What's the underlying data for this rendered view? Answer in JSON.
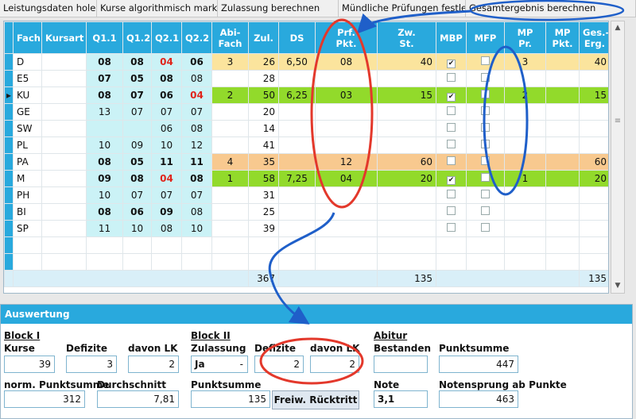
{
  "tabs": [
    "Leistungsdaten holen",
    "Kurse algorithmisch markieren",
    "Zulassung berechnen",
    "Mündliche Prüfungen festlegen",
    "Gesamtergebnis berechnen"
  ],
  "grid": {
    "headers": [
      "Fach",
      "Kursart",
      "Q1.1",
      "Q1.2",
      "Q2.1",
      "Q2.2",
      "Abi-\nFach",
      "Zul.",
      "DS",
      "Prf.\nPkt.",
      "Zw.\nSt.",
      "MBP",
      "MFP",
      "MP\nPr.",
      "MP\nPkt.",
      "Ges.-\nErg."
    ],
    "rows": [
      {
        "fach": "D",
        "kursart": "",
        "q11": "08",
        "q12": "08",
        "q21": "04",
        "q22": "06",
        "abi": "3",
        "zul": "26",
        "ds": "6,50",
        "prf": "08",
        "zw": "40",
        "mbp": "✔",
        "mfp": "",
        "mpr": "3",
        "mpk": "",
        "ges": "40"
      },
      {
        "fach": "E5",
        "kursart": "",
        "q11": "07",
        "q12": "05",
        "q21": "08",
        "q22": "08",
        "abi": "",
        "zul": "28",
        "ds": "",
        "prf": "",
        "zw": "",
        "mbp": "",
        "mfp": "",
        "mpr": "",
        "mpk": "",
        "ges": ""
      },
      {
        "fach": "KU",
        "kursart": "",
        "q11": "08",
        "q12": "07",
        "q21": "06",
        "q22": "04",
        "abi": "2",
        "zul": "50",
        "ds": "6,25",
        "prf": "03",
        "zw": "15",
        "mbp": "✔",
        "mfp": "",
        "mpr": "2",
        "mpk": "",
        "ges": "15"
      },
      {
        "fach": "GE",
        "kursart": "",
        "q11": "13",
        "q12": "07",
        "q21": "07",
        "q22": "07",
        "abi": "",
        "zul": "20",
        "ds": "",
        "prf": "",
        "zw": "",
        "mbp": "",
        "mfp": "",
        "mpr": "",
        "mpk": "",
        "ges": ""
      },
      {
        "fach": "SW",
        "kursart": "",
        "q11": "",
        "q12": "",
        "q21": "06",
        "q22": "08",
        "abi": "",
        "zul": "14",
        "ds": "",
        "prf": "",
        "zw": "",
        "mbp": "",
        "mfp": "",
        "mpr": "",
        "mpk": "",
        "ges": ""
      },
      {
        "fach": "PL",
        "kursart": "",
        "q11": "10",
        "q12": "09",
        "q21": "10",
        "q22": "12",
        "abi": "",
        "zul": "41",
        "ds": "",
        "prf": "",
        "zw": "",
        "mbp": "",
        "mfp": "",
        "mpr": "",
        "mpk": "",
        "ges": ""
      },
      {
        "fach": "PA",
        "kursart": "",
        "q11": "08",
        "q12": "05",
        "q21": "11",
        "q22": "11",
        "abi": "4",
        "zul": "35",
        "ds": "",
        "prf": "12",
        "zw": "60",
        "mbp": "",
        "mfp": "",
        "mpr": "",
        "mpk": "",
        "ges": "60"
      },
      {
        "fach": "M",
        "kursart": "",
        "q11": "09",
        "q12": "08",
        "q21": "04",
        "q22": "08",
        "abi": "1",
        "zul": "58",
        "ds": "7,25",
        "prf": "04",
        "zw": "20",
        "mbp": "✔",
        "mfp": "",
        "mpr": "1",
        "mpk": "",
        "ges": "20"
      },
      {
        "fach": "PH",
        "kursart": "",
        "q11": "10",
        "q12": "07",
        "q21": "07",
        "q22": "07",
        "abi": "",
        "zul": "31",
        "ds": "",
        "prf": "",
        "zw": "",
        "mbp": "",
        "mfp": "",
        "mpr": "",
        "mpk": "",
        "ges": ""
      },
      {
        "fach": "BI",
        "kursart": "",
        "q11": "08",
        "q12": "06",
        "q21": "09",
        "q22": "08",
        "abi": "",
        "zul": "25",
        "ds": "",
        "prf": "",
        "zw": "",
        "mbp": "",
        "mfp": "",
        "mpr": "",
        "mpk": "",
        "ges": ""
      },
      {
        "fach": "SP",
        "kursart": "",
        "q11": "11",
        "q12": "10",
        "q21": "08",
        "q22": "10",
        "abi": "",
        "zul": "39",
        "ds": "",
        "prf": "",
        "zw": "",
        "mbp": "",
        "mfp": "",
        "mpr": "",
        "mpk": "",
        "ges": ""
      }
    ],
    "totals": {
      "zul": "367",
      "zw": "135",
      "ges": "135"
    }
  },
  "auswertung": {
    "title": "Auswertung",
    "block1": {
      "heading": "Block I",
      "kurse_label": "Kurse",
      "kurse": "39",
      "defizite_label": "Defizite",
      "defizite": "3",
      "lk_label": "davon LK",
      "lk": "2",
      "norm_label": "norm. Punktsumme",
      "norm": "312",
      "durch_label": "Durchschnitt",
      "durch": "7,81"
    },
    "block2": {
      "heading": "Block II",
      "zul_label": "Zulassung",
      "zul": "Ja",
      "defizite_label": "Defizite",
      "defizite": "2",
      "lk_label": "davon LK",
      "lk": "2",
      "punkt_label": "Punktsumme",
      "punkt": "135",
      "button": "Freiw. Rücktritt"
    },
    "abitur": {
      "heading": "Abitur",
      "bestanden_label": "Bestanden",
      "bestanden": "",
      "punkt_label": "Punktsumme",
      "punkt": "447",
      "note_label": "Note",
      "note": "3,1",
      "sprung_label": "Notensprung ab Punkte",
      "sprung": "463"
    }
  },
  "colors": {
    "header": "#29a9dd",
    "q_cells": "#cbf2f6",
    "yellow_row": "#fbe49d",
    "green_row": "#92da2b",
    "orange_row": "#f8c98f",
    "red_text": "#e0251b",
    "annotation_red": "#e3382b",
    "annotation_blue": "#1f5fc9"
  }
}
